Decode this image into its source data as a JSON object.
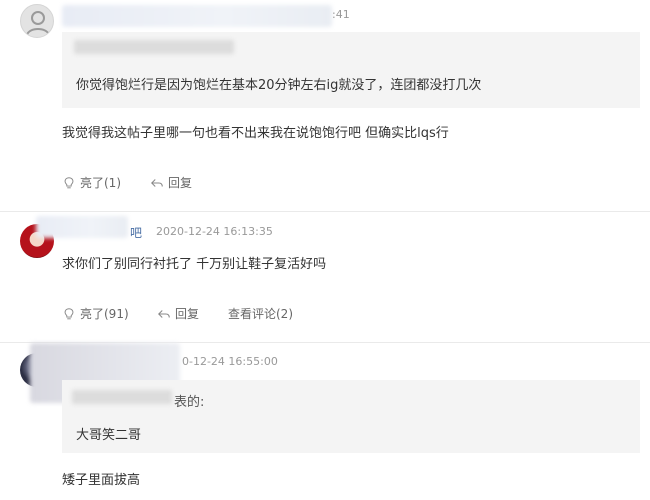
{
  "comments": [
    {
      "time_suffix": ":41",
      "quote_text": "你觉得饱烂行是因为饱烂在基本20分钟左右ig就没了，连团都没打几次",
      "body": "我觉得我这帖子里哪一句也看不出来我在说饱饱行吧 但确实比lqs行",
      "like_label": "亮了(1)",
      "reply_label": "回复"
    },
    {
      "name_suffix": "吧",
      "time": "2020-12-24 16:13:35",
      "body": "求你们了别同行衬托了 千万别让鞋子复活好吗",
      "like_label": "亮了(91)",
      "reply_label": "回复",
      "view_comments_label": "查看评论(2)"
    },
    {
      "time": "0-12-24 16:55:00",
      "quote_label_suffix": "表的:",
      "quote_text": "大哥笑二哥",
      "body": "矮子里面拔高"
    }
  ]
}
